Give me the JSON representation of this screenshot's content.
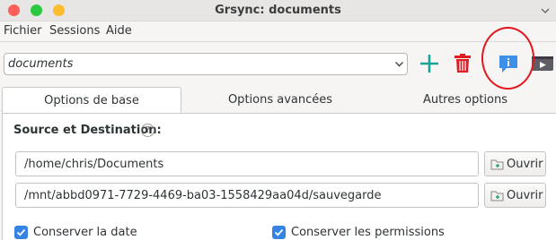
{
  "window": {
    "title": "Grsync: documents"
  },
  "menu": {
    "items": [
      "Fichier",
      "Sessions",
      "Aide"
    ]
  },
  "session": {
    "value": "documents"
  },
  "tabs": [
    "Options de base",
    "Options avancées",
    "Autres options"
  ],
  "basic": {
    "section_title": "Source et Destination:",
    "help_glyph": "?",
    "source_path": "/home/chris/Documents",
    "destination_path": "/mnt/abbd0971-7729-4469-ba03-1558429aa04d/sauvegarde",
    "open_label": "Ouvrir",
    "checkboxes": [
      {
        "label": "Conserver la date",
        "checked": true
      },
      {
        "label": "Conserver les permissions",
        "checked": true
      }
    ]
  },
  "colors": {
    "accent": "#3584e4",
    "add_icon": "#1aa398",
    "delete_icon": "#e01b24",
    "annotation": "#e4151d"
  },
  "icons": [
    "add-icon",
    "trash-icon",
    "info-bubble-icon",
    "run-icon",
    "help-icon",
    "folder-icon",
    "chevron-down-icon"
  ]
}
